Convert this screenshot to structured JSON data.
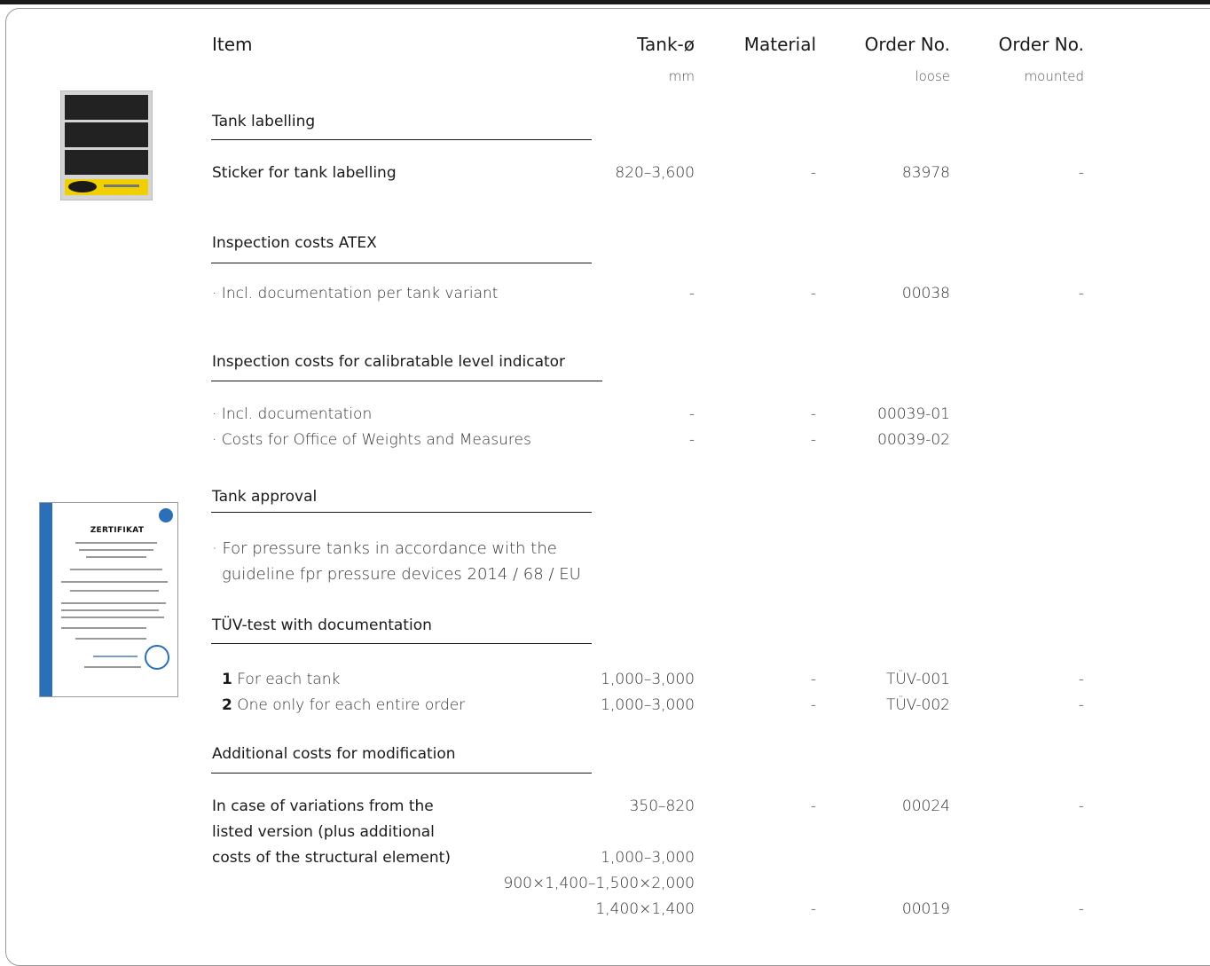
{
  "header": {
    "item": "Item",
    "tank_diameter": "Tank-ø",
    "tank_diameter_unit": "mm",
    "material": "Material",
    "order_loose": "Order No.",
    "order_loose_sub": "loose",
    "order_mounted": "Order No.",
    "order_mounted_sub": "mounted"
  },
  "sections": [
    {
      "title": "Tank labelling",
      "rows": [
        {
          "item": "Sticker for tank labelling",
          "tank": "820–3,600",
          "material": "-",
          "loose": "83978",
          "mounted": "-"
        }
      ]
    },
    {
      "title": "Inspection costs ATEX",
      "rows": [
        {
          "item": "· Incl. documentation per tank variant",
          "tank": "-",
          "material": "-",
          "loose": "00038",
          "mounted": "-"
        }
      ]
    },
    {
      "title": "Inspection costs for calibratable level indicator",
      "rows": [
        {
          "item": "· Incl. documentation",
          "tank": "-",
          "material": "-",
          "loose": "00039-01"
        },
        {
          "item": "· Costs for Office of Weights and Measures",
          "tank": "-",
          "material": "-",
          "loose": "00039-02"
        }
      ]
    },
    {
      "title": "Tank approval",
      "rows": [
        {
          "item_line1": "· For pressure tanks in accordance with the",
          "item_line2": "guideline fpr pressure devices 2014 / 68 / EU"
        }
      ]
    },
    {
      "title": "TÜV-test with documentation",
      "rows": [
        {
          "num": "1",
          "item": "For each tank",
          "tank": "1,000–3,000",
          "material": "-",
          "loose": "TÜV-001",
          "mounted": "-"
        },
        {
          "num": "2",
          "item": "One only for each entire order",
          "tank": "1,000–3,000",
          "material": "-",
          "loose": "TÜV-002",
          "mounted": "-"
        }
      ]
    },
    {
      "title": "Additional costs for modification",
      "rows": [
        {
          "item_line1": "In case of variations from the",
          "item_line2": "listed version (plus additional",
          "item_line3": "costs of the structural element)",
          "tank1": "350–820",
          "material1": "-",
          "loose1": "00024",
          "mounted1": "-",
          "tank2": "1,000–3,000",
          "tank3": "900×1,400–1,500×2,000",
          "tank4": "1,400×1,400",
          "material4": "-",
          "loose4": "00019",
          "mounted4": "-"
        }
      ]
    }
  ],
  "images": {
    "certificate_title": "ZERTIFIKAT"
  }
}
